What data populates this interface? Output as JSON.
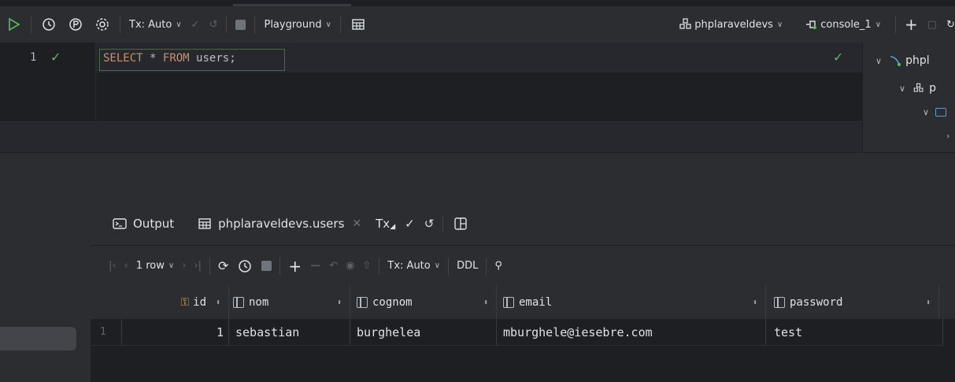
{
  "toolbar": {
    "tx_mode": "Tx: Auto",
    "playground": "Playground",
    "datasource": "phplaraveldevs",
    "console": "console_1"
  },
  "editor": {
    "line_number": "1",
    "query_keyword_select": "SELECT",
    "query_star": "*",
    "query_keyword_from": "FROM",
    "query_table": "users",
    "query_end": ";"
  },
  "tree": {
    "root_label": "phpl",
    "schema_label": "p"
  },
  "results": {
    "tabs": [
      {
        "label": "Output"
      },
      {
        "label": "phplaraveldevs.users"
      }
    ],
    "tx_short": "Tx",
    "row_count": "1 row",
    "tx_mode": "Tx: Auto",
    "ddl": "DDL",
    "columns": [
      "id",
      "nom",
      "cognom",
      "email",
      "password"
    ],
    "rows": [
      {
        "num": "1",
        "id": "1",
        "nom": "sebastian",
        "cognom": "burghelea",
        "email": "mburghele@iesebre.com",
        "password": "test"
      }
    ]
  },
  "colors": {
    "success": "#5fb865",
    "keyword": "#cf8e6d",
    "background": "#1e1f22",
    "panel": "#2b2d30"
  }
}
